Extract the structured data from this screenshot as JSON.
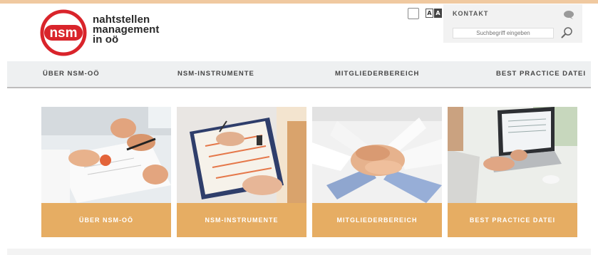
{
  "logo": {
    "line1": "nahtstellen",
    "line2": "management",
    "line3": "in oö",
    "mark_text": "nsm"
  },
  "utility": {
    "kontakt": "KONTAKT",
    "search_placeholder": "Suchbegriff eingeben",
    "font_toggle_a1": "A",
    "font_toggle_a2": "A"
  },
  "nav": {
    "items": [
      "ÜBER NSM-OÖ",
      "NSM-INSTRUMENTE",
      "MITGLIEDERBEREICH",
      "BEST PRACTICE DATEI"
    ]
  },
  "tiles": [
    {
      "label": "ÜBER NSM-OÖ",
      "image": "hands-with-pen-and-document"
    },
    {
      "label": "NSM-INSTRUMENTE",
      "image": "filling-in-form-on-clipboard"
    },
    {
      "label": "MITGLIEDERBEREICH",
      "image": "stacked-hands-teamwork"
    },
    {
      "label": "BEST PRACTICE DATEI",
      "image": "person-typing-on-laptop"
    }
  ],
  "colors": {
    "accent": "#e6ad63",
    "logo_red": "#d9242b",
    "nav_bg": "#eef0f1"
  }
}
